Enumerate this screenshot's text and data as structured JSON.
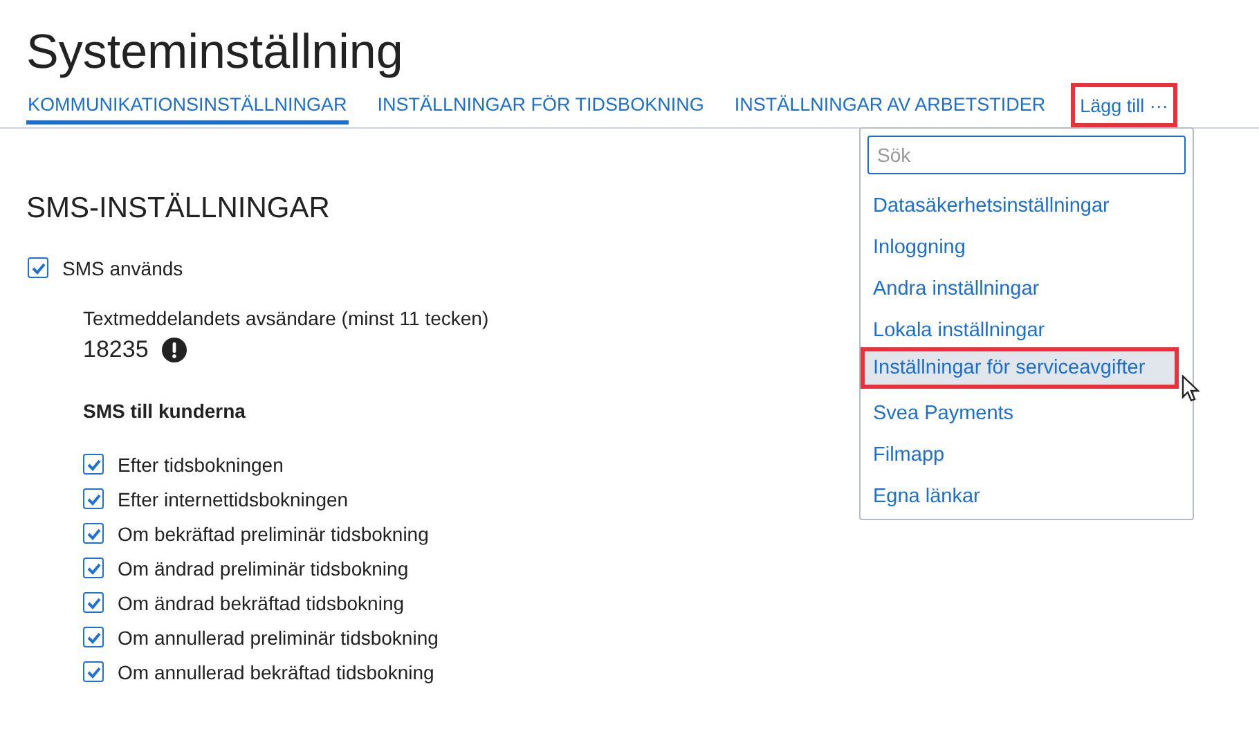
{
  "title": "Systeminställning",
  "tabs": [
    {
      "label": "KOMMUNIKATIONSINSTÄLLNINGAR",
      "selected": true
    },
    {
      "label": "INSTÄLLNINGAR FÖR TIDSBOKNING",
      "selected": false
    },
    {
      "label": "INSTÄLLNINGAR AV ARBETSTIDER",
      "selected": false
    }
  ],
  "more_tab": {
    "label": "Lägg till",
    "icon": "···",
    "highlighted": true
  },
  "menu": {
    "search": {
      "placeholder": "Sök"
    },
    "items": [
      {
        "label": "Datasäkerhetsinställningar",
        "selected": false,
        "highlighted": false
      },
      {
        "label": "Inloggning",
        "selected": false,
        "highlighted": false
      },
      {
        "label": "Andra inställningar",
        "selected": false,
        "highlighted": false
      },
      {
        "label": "Lokala inställningar",
        "selected": false,
        "highlighted": false
      },
      {
        "label": "Inställningar för serviceavgifter",
        "selected": true,
        "highlighted": true
      },
      {
        "label": "Svea Payments",
        "selected": false,
        "highlighted": false
      },
      {
        "label": "Filmapp",
        "selected": false,
        "highlighted": false
      },
      {
        "label": "Egna länkar",
        "selected": false,
        "highlighted": false
      }
    ]
  },
  "section": {
    "heading": "SMS-INSTÄLLNINGAR",
    "sms_used": {
      "label": "SMS används",
      "checked": true
    },
    "sender": {
      "label": "Textmeddelandets avsändare (minst 11 tecken)",
      "value": "18235",
      "warning": true
    },
    "subheading": "SMS till kunderna",
    "options": [
      {
        "label": "Efter tidsbokningen",
        "checked": true
      },
      {
        "label": "Efter internettidsbokningen",
        "checked": true
      },
      {
        "label": "Om bekräftad preliminär tidsbokning",
        "checked": true
      },
      {
        "label": "Om ändrad preliminär tidsbokning",
        "checked": true
      },
      {
        "label": "Om ändrad bekräftad tidsbokning",
        "checked": true
      },
      {
        "label": "Om annullerad preliminär tidsbokning",
        "checked": true
      },
      {
        "label": "Om annullerad bekräftad tidsbokning",
        "checked": true
      }
    ]
  }
}
